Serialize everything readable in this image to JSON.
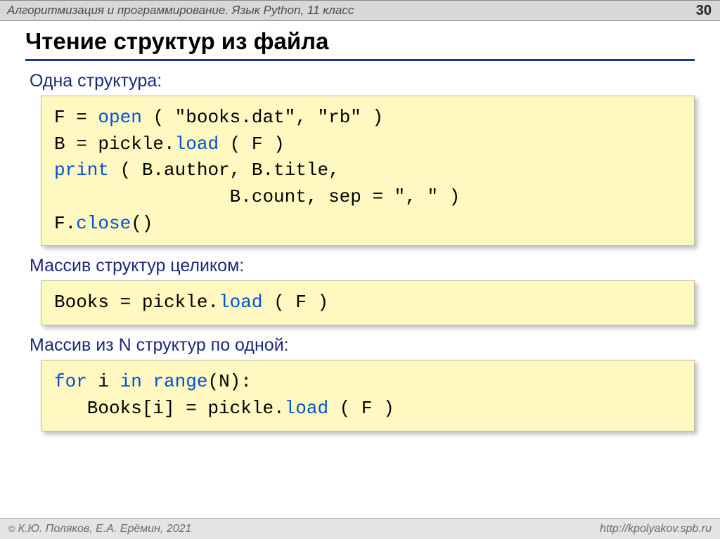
{
  "header": {
    "title": "Алгоритмизация и программирование. Язык Python, 11 класс",
    "page": "30"
  },
  "slide": {
    "title": "Чтение структур из файла",
    "section1_label": "Одна структура",
    "section2_label": "Массив структур целиком",
    "section3_label": "Массив из N структур по одной"
  },
  "code1": {
    "l1a": "F = ",
    "l1b": "open",
    "l1c": " ( \"books.dat\", \"rb\" )",
    "l2a": "B = pickle.",
    "l2b": "load",
    "l2c": " ( F )",
    "l3a": "print",
    "l3b": " ( B.author, B.title,",
    "l4": "                B.count, sep = \", \" )",
    "l5a": "F.",
    "l5b": "close",
    "l5c": "()"
  },
  "code2": {
    "l1a": "Books = pickle.",
    "l1b": "load",
    "l1c": " ( F )"
  },
  "code3": {
    "l1a": "for",
    "l1b": " i ",
    "l1c": "in",
    "l1d": " ",
    "l1e": "range",
    "l1f": "(N):",
    "l2a": "   Books[i] = pickle.",
    "l2b": "load",
    "l2c": " ( F )"
  },
  "footer": {
    "authors": "К.Ю. Поляков, Е.А. Ерёмин, 2021",
    "url": "http://kpolyakov.spb.ru"
  }
}
